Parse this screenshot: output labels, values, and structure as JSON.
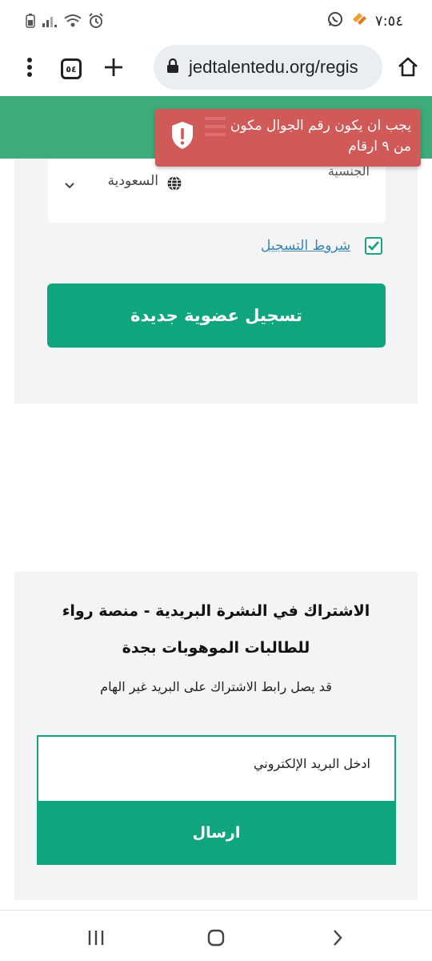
{
  "status_bar": {
    "time": "٧:٥٤",
    "left_icons": [
      "battery-icon",
      "signal-icon",
      "wifi-icon",
      "alarm-icon"
    ],
    "right_icons": [
      "whatsapp-icon",
      "app-notification-icon"
    ]
  },
  "browser": {
    "tab_count": "٥٤",
    "url": "jedtalentedu.org/regis",
    "icons": [
      "home-icon",
      "lock-icon",
      "new-tab-icon",
      "more-vert-icon"
    ]
  },
  "toast": {
    "message": "يجب ان يكون رقم الجوال مكون من ٩ ارقام",
    "color": "#cf5a58"
  },
  "form": {
    "nationality_label": "الجنسية",
    "nationality_value": "السعودية",
    "terms_label": "شروط التسجيل",
    "terms_checked": true,
    "register_button": "تسجيل عضوية جديدة"
  },
  "newsletter": {
    "title": "الاشتراك في النشرة البريدية - منصة رواء للطالبات الموهوبات بجدة",
    "subtitle": "قد يصل رابط الاشتراك على البريد غير الهام",
    "email_placeholder": "ادخل البريد الإلكتروني",
    "send_button": "ارسال"
  },
  "colors": {
    "accent": "#0fa67f",
    "header_green": "#3faa7a",
    "link": "#3a86b0"
  }
}
